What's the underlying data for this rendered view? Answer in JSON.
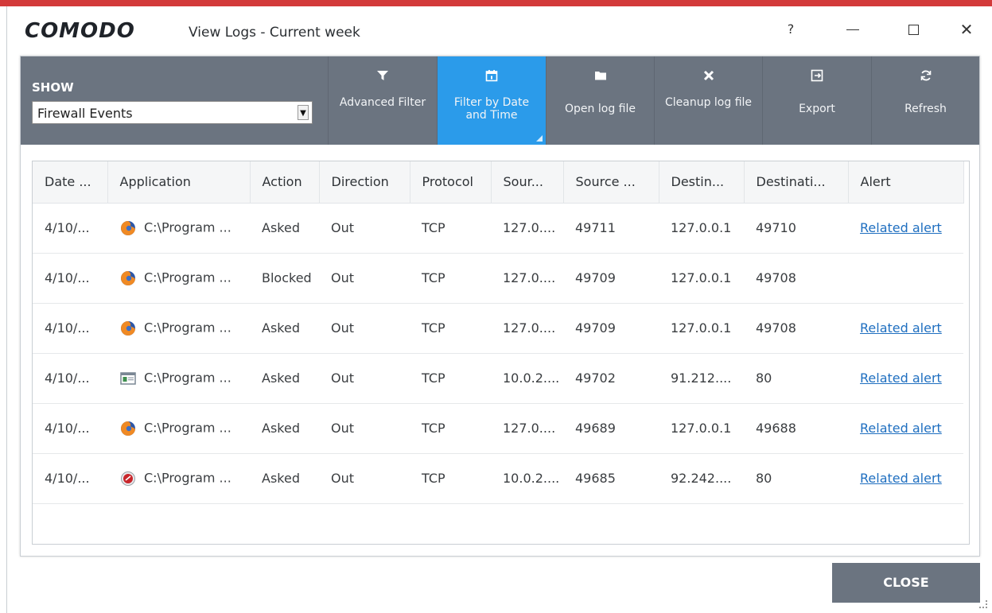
{
  "window": {
    "logo": "COMODO",
    "title": "View Logs - Current week",
    "controls": {
      "help": "?",
      "close": "✕"
    }
  },
  "toolbar": {
    "show_label": "SHOW",
    "show_select_value": "Firewall Events",
    "buttons": [
      {
        "label": "Advanced Filter",
        "icon": "filter-icon",
        "active": false
      },
      {
        "label": "Filter by Date and Time",
        "icon": "calendar-icon",
        "active": true
      },
      {
        "label": "Open log file",
        "icon": "folder-icon",
        "active": false
      },
      {
        "label": "Cleanup log file",
        "icon": "x-icon",
        "active": false
      },
      {
        "label": "Export",
        "icon": "export-icon",
        "active": false
      },
      {
        "label": "Refresh",
        "icon": "refresh-icon",
        "active": false
      }
    ],
    "active_color": "#2b9bea",
    "bar_color": "#6b7480"
  },
  "table": {
    "columns": [
      "Date ...",
      "Application",
      "Action",
      "Direction",
      "Protocol",
      "Sour...",
      "Source ...",
      "Destin...",
      "Destinati...",
      "Alert"
    ],
    "rows": [
      {
        "date": "4/10/...",
        "app_icon": "firefox-icon",
        "application": "C:\\Program ...",
        "action": "Asked",
        "direction": "Out",
        "protocol": "TCP",
        "source_ip": "127.0....",
        "source_port": "49711",
        "dest_ip": "127.0.0.1",
        "dest_port": "49710",
        "alert": "Related alert"
      },
      {
        "date": "4/10/...",
        "app_icon": "firefox-icon",
        "application": "C:\\Program ...",
        "action": "Blocked",
        "direction": "Out",
        "protocol": "TCP",
        "source_ip": "127.0....",
        "source_port": "49709",
        "dest_ip": "127.0.0.1",
        "dest_port": "49708",
        "alert": ""
      },
      {
        "date": "4/10/...",
        "app_icon": "firefox-icon",
        "application": "C:\\Program ...",
        "action": "Asked",
        "direction": "Out",
        "protocol": "TCP",
        "source_ip": "127.0....",
        "source_port": "49709",
        "dest_ip": "127.0.0.1",
        "dest_port": "49708",
        "alert": "Related alert"
      },
      {
        "date": "4/10/...",
        "app_icon": "window-app-icon",
        "application": "C:\\Program ...",
        "action": "Asked",
        "direction": "Out",
        "protocol": "TCP",
        "source_ip": "10.0.2....",
        "source_port": "49702",
        "dest_ip": "91.212....",
        "dest_port": "80",
        "alert": "Related alert"
      },
      {
        "date": "4/10/...",
        "app_icon": "firefox-icon",
        "application": "C:\\Program ...",
        "action": "Asked",
        "direction": "Out",
        "protocol": "TCP",
        "source_ip": "127.0....",
        "source_port": "49689",
        "dest_ip": "127.0.0.1",
        "dest_port": "49688",
        "alert": "Related alert"
      },
      {
        "date": "4/10/...",
        "app_icon": "red-circle-app-icon",
        "application": "C:\\Program ...",
        "action": "Asked",
        "direction": "Out",
        "protocol": "TCP",
        "source_ip": "10.0.2....",
        "source_port": "49685",
        "dest_ip": "92.242....",
        "dest_port": "80",
        "alert": "Related alert"
      }
    ],
    "link_color": "#1f6fc0"
  },
  "footer": {
    "close_label": "CLOSE"
  }
}
